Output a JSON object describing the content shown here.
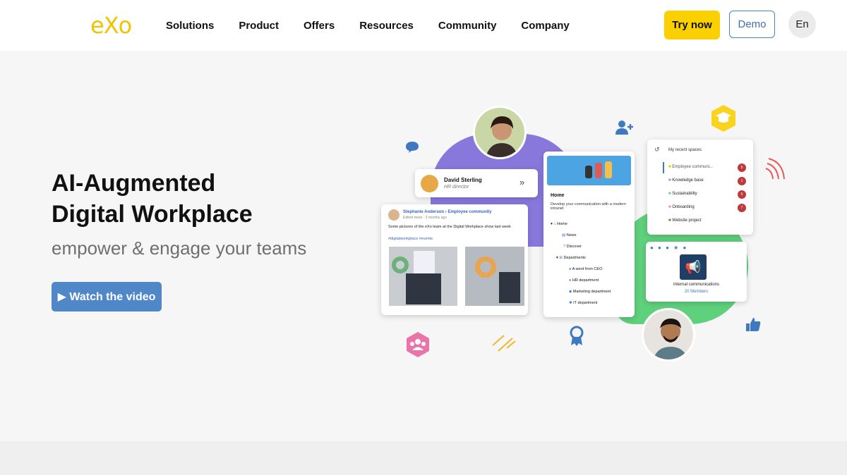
{
  "header": {
    "logo": "eXo",
    "nav": [
      "Solutions",
      "Product",
      "Offers",
      "Resources",
      "Community",
      "Company"
    ],
    "try_label": "Try now",
    "demo_label": "Demo",
    "lang_label": "En"
  },
  "hero": {
    "title_line1": "AI-Augmented",
    "title_line2": "Digital Workplace",
    "subtitle": "empower & engage your teams",
    "video_label": "▶ Watch the video"
  },
  "illustration": {
    "profile": {
      "name": "David Sterling",
      "role": "HR director"
    },
    "post": {
      "author": "Stephanie Anderson",
      "space": "Employee community",
      "meta": "Edited news · 3 months ago",
      "text": "Some pictures of the eXo team at the Digital Workplace show last week",
      "tags": "#digitalworkplace #events"
    },
    "nav_card": {
      "title": "Home",
      "desc": "Develop your communication with a modern intranet",
      "items": [
        "Home",
        "News",
        "Discover",
        "Departments",
        "A word from CEO",
        "HR department",
        "Marketing department",
        "IT department"
      ]
    },
    "spaces": {
      "title": "My recent spaces",
      "items": [
        {
          "label": "Employee communi...",
          "count": "5"
        },
        {
          "label": "Knowledge base",
          "count": "1"
        },
        {
          "label": "Sustainability",
          "count": "5"
        },
        {
          "label": "Onboarding",
          "count": "7"
        },
        {
          "label": "Website project",
          "count": ""
        }
      ]
    },
    "comm_card": {
      "title": "Internal communications",
      "members": "20 Members"
    }
  },
  "colors": {
    "accent_yellow": "#fad000",
    "brand_blue": "#4f87c9",
    "purple_blob": "#8878dc",
    "green_blob": "#5fd07c",
    "badge_red": "#c0393b"
  }
}
